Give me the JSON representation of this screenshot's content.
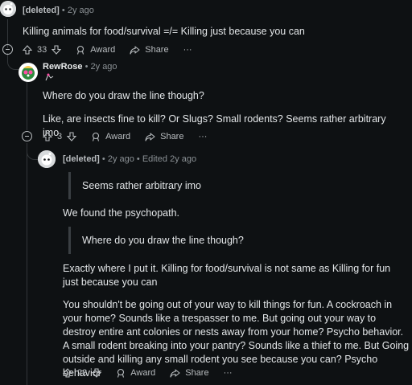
{
  "comments": [
    {
      "author": "[deleted]",
      "age": "2y ago",
      "body": "Killing animals for food/survival =/= Killing just because you can",
      "votes": "33",
      "award_label": "Award",
      "share_label": "Share",
      "more_label": "···"
    },
    {
      "author": "RewRose",
      "age": "2y ago",
      "flair_icon": "pinkhair-flair-icon",
      "paragraphs": [
        "Where do you draw the line though?",
        "Like, are insects fine to kill? Or Slugs? Small rodents? Seems rather arbitrary imo"
      ],
      "votes": "3",
      "award_label": "Award",
      "share_label": "Share",
      "more_label": "···"
    },
    {
      "author": "[deleted]",
      "age": "2y ago",
      "edited": "Edited 2y ago",
      "quote1": "Seems rather arbitrary imo",
      "para1": "We found the psychopath.",
      "quote2": "Where do you draw the line though?",
      "para2": "Exactly where I put it. Killing for food/survival is not same as Killing for fun just because you can",
      "para3": "You shouldn't be going out of your way to kill things for fun. A cockroach in your home? Sounds like a trespasser to me. But going out your way to destroy entire ant colonies or nests away from your home? Psycho behavior. A small rodent breaking into your pantry? Sounds like a thief to me. But Going outside and killing any small rodent you see because you can? Psycho behavior",
      "votes": "22",
      "award_label": "Award",
      "share_label": "Share",
      "more_label": "···"
    }
  ],
  "separator": "•",
  "colors": {
    "background": "#0e1113",
    "text": "#e3e6e8",
    "muted": "#8a9094"
  }
}
